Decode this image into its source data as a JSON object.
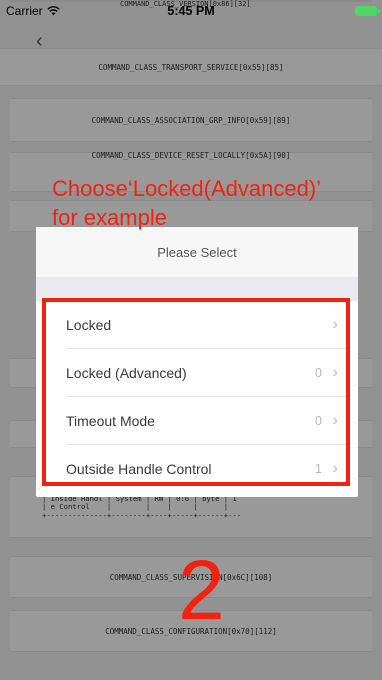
{
  "status_bar": {
    "carrier": "Carrier",
    "time": "5:45 PM"
  },
  "background": {
    "top_partial": "COMMAND_CLASS_VERSION[0x86][32]",
    "items": [
      "COMMAND_CLASS_TRANSPORT_SERVICE[0x55][85]",
      "COMMAND_CLASS_ASSOCIATION_GRP_INFO[0x59][89]",
      "COMMAND_CLASS_DEVICE_RESET_LOCALLY[0x5A][90]",
      "COMMAND_CLASS_SUPERVISION[0x6C][108]",
      "COMMAND_CLASS_CONFIGURATION[0x70][112]"
    ],
    "table_text": "| le Control   |        |    |     |      |   \n| Inside Handl | System | RW | 0:6 | byte | 1 \n| e Control    |        |    |     |      |   \n+--------------+--------+----+-----+------+---"
  },
  "modal": {
    "title": "Please Select",
    "options": [
      {
        "label": "Locked",
        "value": ""
      },
      {
        "label": "Locked (Advanced)",
        "value": "0"
      },
      {
        "label": "Timeout Mode",
        "value": "0"
      },
      {
        "label": "Outside Handle Control",
        "value": "1"
      }
    ]
  },
  "annotation": {
    "line1": "Choose‘Locked(Advanced)’",
    "line2": "for example",
    "step_number": "2",
    "color": "#f2220e"
  },
  "icons": {
    "wifi": "wifi-icon",
    "battery": "battery-icon",
    "back": "chevron-left-icon",
    "option_arrow": "chevron-right-icon"
  }
}
